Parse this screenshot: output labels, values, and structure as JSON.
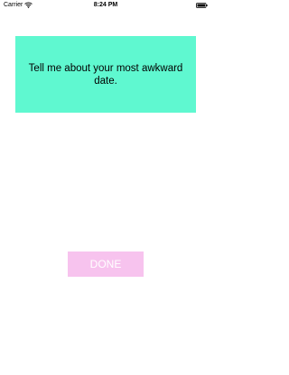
{
  "status_bar": {
    "carrier": "Carrier",
    "time": "8:24 PM",
    "wifi_icon": "wifi-icon",
    "battery_icon": "battery-icon"
  },
  "prompt": {
    "text": "Tell me about your most awkward date."
  },
  "done_button": {
    "label": "DONE"
  },
  "colors": {
    "card_background": "#5ff8d0",
    "button_background": "#f7c3ee",
    "button_text": "#ffffff"
  }
}
